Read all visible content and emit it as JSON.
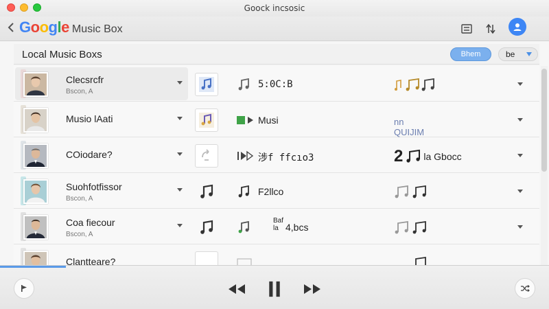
{
  "window": {
    "title": "Goock incsosic"
  },
  "brand": {
    "logo_letters": [
      "G",
      "o",
      "o",
      "g",
      "l",
      "e"
    ],
    "name": "Music Box"
  },
  "toolbar": {
    "icons": [
      "list-icon",
      "sort-icon",
      "user-icon"
    ]
  },
  "section": {
    "title": "Local Music Boxs",
    "action_label": "Bhem",
    "select_value": "be"
  },
  "rows": [
    {
      "title": "Clecsrcfr",
      "subtitle": "Bscon, A",
      "track_text": "5:0C:B",
      "extra_text": "",
      "tile_style": "boxed",
      "accent": "#ead8d8"
    },
    {
      "title": "Musio lAati",
      "subtitle": "",
      "track_text": "Musi",
      "extra_text": "nn QUIJIM",
      "tile_style": "boxed",
      "accent": "#e6e1d8"
    },
    {
      "title": "COiodare?",
      "subtitle": "",
      "track_text": "涉f ffcıo3",
      "extra_text": "la Gbocc",
      "extra_num": "2",
      "tile_style": "boxed",
      "accent": "#dfe4e8"
    },
    {
      "title": "Suohfotfissor",
      "subtitle": "Bscon, A",
      "track_text": "F2llco",
      "extra_text": "",
      "tile_style": "plain",
      "accent": "#c7e6e9"
    },
    {
      "title": "Coa fiecour",
      "subtitle": "Bscon, A",
      "track_text": "4,bcs",
      "track_small": "Baf la",
      "extra_text": "",
      "tile_style": "plain",
      "accent": "#e0e0e0"
    },
    {
      "title": "Clantteare?",
      "subtitle": "",
      "track_text": "",
      "extra_text": "",
      "tile_style": "boxed",
      "accent": "#e3e3e3"
    }
  ],
  "player": {
    "progress": 0.12
  },
  "colors": {
    "accent": "#3d86f5",
    "pill": "#7bb0ee"
  }
}
